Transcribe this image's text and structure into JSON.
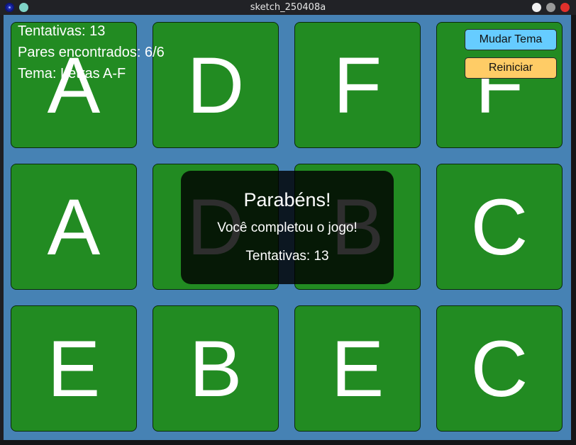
{
  "window": {
    "title": "sketch_250408a"
  },
  "hud": {
    "attempts": "Tentativas: 13",
    "pairs": "Pares encontrados: 6/6",
    "theme": "Tema: Letras A-F"
  },
  "buttons": {
    "change_theme": "Mudar Tema",
    "restart": "Reiniciar"
  },
  "colors": {
    "background": "#4682b4",
    "card": "#228b22",
    "change_theme_button": "#66ccff",
    "restart_button": "#ffcc66"
  },
  "cards": [
    {
      "letter": "A",
      "matched": true
    },
    {
      "letter": "D",
      "matched": true
    },
    {
      "letter": "F",
      "matched": true
    },
    {
      "letter": "F",
      "matched": true
    },
    {
      "letter": "A",
      "matched": true
    },
    {
      "letter": "D",
      "matched": true
    },
    {
      "letter": "B",
      "matched": true
    },
    {
      "letter": "C",
      "matched": true
    },
    {
      "letter": "E",
      "matched": true
    },
    {
      "letter": "B",
      "matched": true
    },
    {
      "letter": "E",
      "matched": true
    },
    {
      "letter": "C",
      "matched": true
    }
  ],
  "overlay": {
    "title": "Parabéns!",
    "message": "Você completou o jogo!",
    "attempts": "Tentativas: 13"
  }
}
